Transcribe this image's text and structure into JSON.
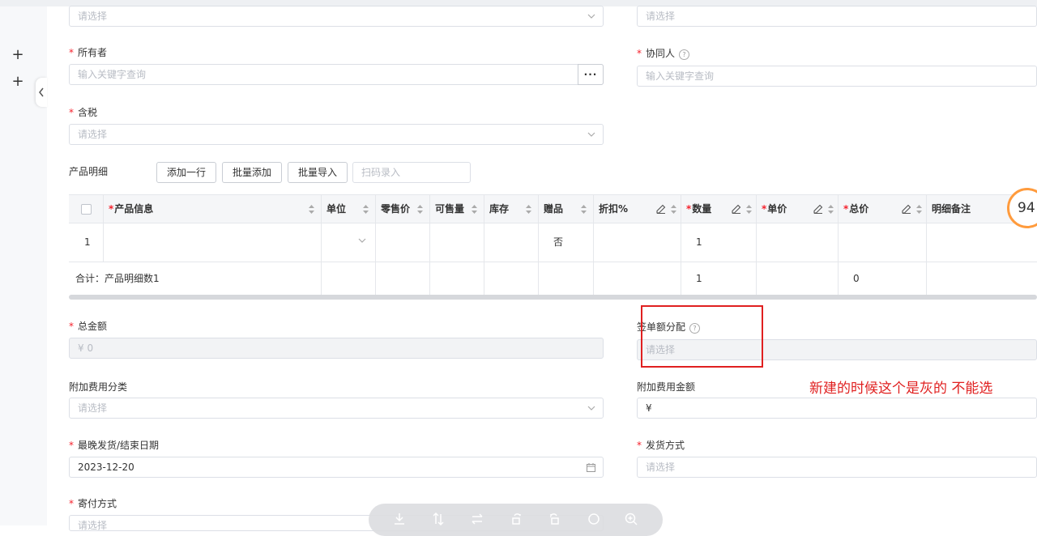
{
  "form": {
    "top_left_placeholder": "请选择",
    "top_right_placeholder": "请选择",
    "owner": {
      "label": "所有者",
      "placeholder": "输入关键字查询",
      "more": "···"
    },
    "collaborator": {
      "label": "协同人",
      "help": "?",
      "placeholder": "输入关键字查询"
    },
    "tax": {
      "label": "含税",
      "placeholder": "请选择"
    },
    "total_amount": {
      "label": "总金额",
      "value": "¥ 0"
    },
    "order_amount_allocation": {
      "label": "签单额分配",
      "help": "?",
      "placeholder": "请选择"
    },
    "extra_fee_category": {
      "label": "附加费用分类",
      "placeholder": "请选择"
    },
    "extra_fee_amount": {
      "label": "附加费用金额",
      "value": "¥"
    },
    "latest_ship_date": {
      "label": "最晚发货/结束日期",
      "value": "2023-12-20"
    },
    "shipping_method": {
      "label": "发货方式",
      "placeholder": "请选择"
    },
    "payment_method": {
      "label": "寄付方式",
      "placeholder": "请选择"
    }
  },
  "product_detail": {
    "label": "产品明细",
    "buttons": {
      "add_row": "添加一行",
      "batch_add": "批量添加",
      "batch_import": "批量导入"
    },
    "scan_placeholder": "扫码录入",
    "columns": [
      "产品信息",
      "单位",
      "零售价",
      "可售量",
      "库存",
      "赠品",
      "折扣%",
      "数量",
      "单价",
      "总价",
      "明细备注"
    ],
    "rows": [
      {
        "index": "1",
        "product": "",
        "unit": "",
        "retail": "",
        "available": "",
        "stock": "",
        "gift": "否",
        "discount": "",
        "qty": "1",
        "price": "",
        "total": "",
        "remark": ""
      }
    ],
    "summary": {
      "label": "合计：产品明细数1",
      "qty": "1",
      "total": "0"
    }
  },
  "annotation": {
    "text": "新建的时候这个是灰的 不能选"
  },
  "badge": {
    "value": "94"
  },
  "colors": {
    "required": "#f5222d",
    "annotation": "#e02020",
    "badge_ring": "#ff9b3d"
  }
}
